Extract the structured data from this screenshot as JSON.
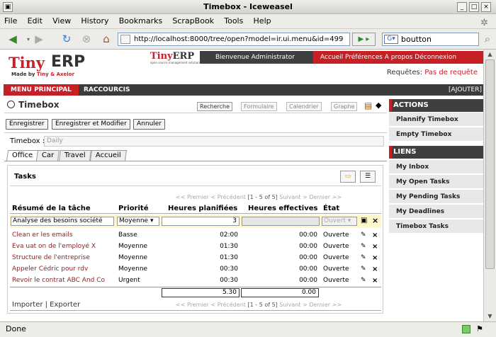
{
  "window": {
    "title": "Timebox - Iceweasel"
  },
  "menubar": [
    "File",
    "Edit",
    "View",
    "History",
    "Bookmarks",
    "ScrapBook",
    "Tools",
    "Help"
  ],
  "toolbar": {
    "url": "http://localhost:8000/tree/open?model=ir.ui.menu&id=499",
    "search": "boutton"
  },
  "header": {
    "welcome": "Bienvenue Administrator",
    "nav": "Accueil  Préférences  A propos  Déconnexion",
    "requetes_label": "Requêtes:",
    "requetes_value": "Pas de requête",
    "logo_tiny": "Tiny",
    "logo_erp": "ERP",
    "logo_made_by": "Made by",
    "logo_made_by_brand": "Tiny & Axelor",
    "logo2_tiny": "Tiny",
    "logo2_erp": "ERP",
    "logo2_sub": "open source management solution"
  },
  "mainbar": {
    "menu_principal": "MENU PRINCIPAL",
    "raccourcis": "RACCOURCIS",
    "ajouter": "[AJOUTER]"
  },
  "page": {
    "title": "Timebox",
    "views": [
      "Recherche",
      "Formulaire",
      "Calendrier",
      "Graphe"
    ]
  },
  "actions": {
    "save": "Enregistrer",
    "save_edit": "Enregistrer et Modifier",
    "cancel": "Annuler"
  },
  "form": {
    "timebox_label": "Timebox :",
    "timebox_value": "Daily"
  },
  "tabs": [
    "Office",
    "Car",
    "Travel",
    "Accueil"
  ],
  "tasks": {
    "title": "Tasks",
    "pager": {
      "first": "<< Premier",
      "prev": "< Précédent",
      "range": "[1 - 5 of 5]",
      "next": "Suivant >",
      "last": "Dernier >>"
    },
    "columns": [
      "Résumé de la tâche",
      "Priorité",
      "Heures planifiées",
      "Heures effectives",
      "État"
    ],
    "edit": {
      "name": "Analyse des besoins société",
      "priority": "Moyenne",
      "planned": "3",
      "effective": "",
      "state": "Ouvert"
    },
    "rows": [
      {
        "name": "Clean er les emails",
        "priority": "Basse",
        "planned": "02:00",
        "effective": "00:00",
        "state": "Ouverte"
      },
      {
        "name": "Eva uat on de l'employé X",
        "priority": "Moyenne",
        "planned": "01:30",
        "effective": "00:00",
        "state": "Ouverte"
      },
      {
        "name": "Structure de l'entreprise",
        "priority": "Moyenne",
        "planned": "01:30",
        "effective": "00:00",
        "state": "Ouverte"
      },
      {
        "name": "Appeler Cédric pour rdv",
        "priority": "Moyenne",
        "planned": "00:30",
        "effective": "00:00",
        "state": "Ouverte"
      },
      {
        "name": "Revoir le contrat ABC And Co",
        "priority": "Urgent",
        "planned": "00:30",
        "effective": "00:00",
        "state": "Ouverte"
      }
    ],
    "sum_planned": "5.30",
    "sum_effective": "0.00",
    "import_export": "Importer | Exporter"
  },
  "sidebar": {
    "actions_title": "ACTIONS",
    "actions": [
      "Plannify Timebox",
      "Empty Timebox"
    ],
    "liens_title": "LIENS",
    "liens": [
      "My Inbox",
      "My Open Tasks",
      "My Pending Tasks",
      "My Deadlines",
      "Timebox Tasks"
    ]
  },
  "status": {
    "text": "Done"
  },
  "colors": {
    "accent": "#c62025",
    "dark": "#3f3f3f"
  }
}
